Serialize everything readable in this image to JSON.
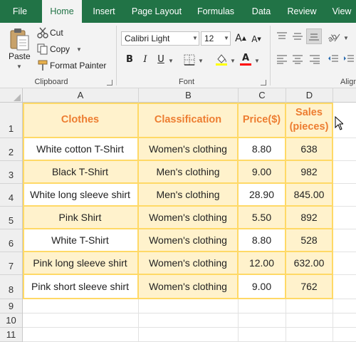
{
  "menu": {
    "tabs": [
      "File",
      "Home",
      "Insert",
      "Page Layout",
      "Formulas",
      "Data",
      "Review",
      "View"
    ],
    "active": "Home"
  },
  "ribbon": {
    "clipboard": {
      "paste_label": "Paste",
      "cut_label": "Cut",
      "copy_label": "Copy",
      "format_painter_label": "Format Painter",
      "group_label": "Clipboard"
    },
    "font": {
      "font_name": "Calibri Light",
      "font_size": "12",
      "bold_label": "B",
      "italic_label": "I",
      "underline_label": "U",
      "grow_label": "A",
      "shrink_label": "A",
      "font_color_label": "A",
      "group_label": "Font",
      "highlight_color": "#ffff00",
      "font_color": "#ff0000"
    },
    "alignment": {
      "group_label": "Align"
    }
  },
  "sheet": {
    "columns": [
      "A",
      "B",
      "C",
      "D"
    ],
    "rows": [
      "1",
      "2",
      "3",
      "4",
      "5",
      "6",
      "7",
      "8",
      "9",
      "10",
      "11"
    ],
    "header_color": "#ed7d31",
    "fill_color": "#fff2cc",
    "border_color": "#ffd966",
    "headers": [
      "Clothes",
      "Classification",
      "Price($)",
      "Sales (pieces)"
    ],
    "data": [
      [
        "White cotton T-Shirt",
        "Women's clothing",
        "8.80",
        "638"
      ],
      [
        "Black T-Shirt",
        "Men's clothing",
        "9.00",
        "982"
      ],
      [
        "White long sleeve shirt",
        "Men's clothing",
        "28.90",
        "845.00"
      ],
      [
        "Pink Shirt",
        "Women's clothing",
        "5.50",
        "892"
      ],
      [
        "White T-Shirt",
        "Women's clothing",
        "8.80",
        "528"
      ],
      [
        "Pink long sleeve shirt",
        "Women's clothing",
        "12.00",
        "632.00"
      ],
      [
        "Pink short sleeve shirt",
        "Women's clothing",
        "9.00",
        "762"
      ]
    ]
  }
}
